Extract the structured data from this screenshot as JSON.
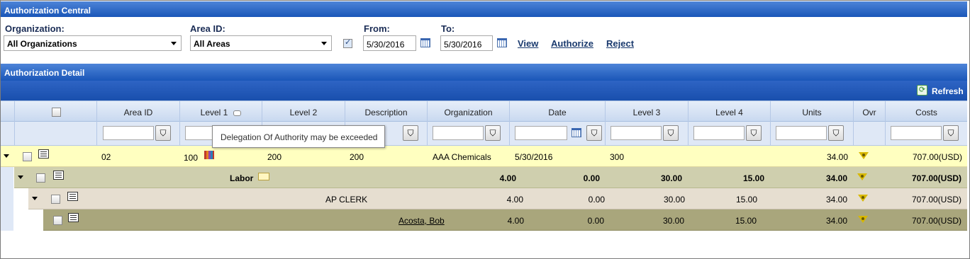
{
  "header": {
    "title": "Authorization Central"
  },
  "filters": {
    "organization_label": "Organization:",
    "organization_value": "All Organizations",
    "area_label": "Area ID:",
    "area_value": "All Areas",
    "from_label": "From:",
    "from_value": "5/30/2016",
    "to_label": "To:",
    "to_value": "5/30/2016",
    "view_link": "View",
    "authorize_link": "Authorize",
    "reject_link": "Reject"
  },
  "detail": {
    "title": "Authorization Detail",
    "refresh_label": "Refresh",
    "columns": [
      "Area ID",
      "Level 1",
      "Level 2",
      "Description",
      "Organization",
      "Date",
      "Level 3",
      "Level 4",
      "Units",
      "Ovr",
      "Costs"
    ],
    "tooltip": "Delegation Of Authority may be exceeded",
    "row1": {
      "area_id": "02",
      "level1": "100",
      "level2": "200",
      "description": "200",
      "organization": "AAA Chemicals",
      "date": "5/30/2016",
      "level3": "300",
      "units": "34.00",
      "costs": "707.00(USD)"
    },
    "row2": {
      "label": "Labor",
      "v1": "4.00",
      "v2": "0.00",
      "v3": "30.00",
      "v4": "15.00",
      "units": "34.00",
      "costs": "707.00(USD)"
    },
    "row3": {
      "label": "AP CLERK",
      "v1": "4.00",
      "v2": "0.00",
      "v3": "30.00",
      "v4": "15.00",
      "units": "34.00",
      "costs": "707.00(USD)"
    },
    "row4": {
      "label": "Acosta, Bob",
      "v1": "4.00",
      "v2": "0.00",
      "v3": "30.00",
      "v4": "15.00",
      "units": "34.00",
      "costs": "707.00(USD)"
    }
  }
}
